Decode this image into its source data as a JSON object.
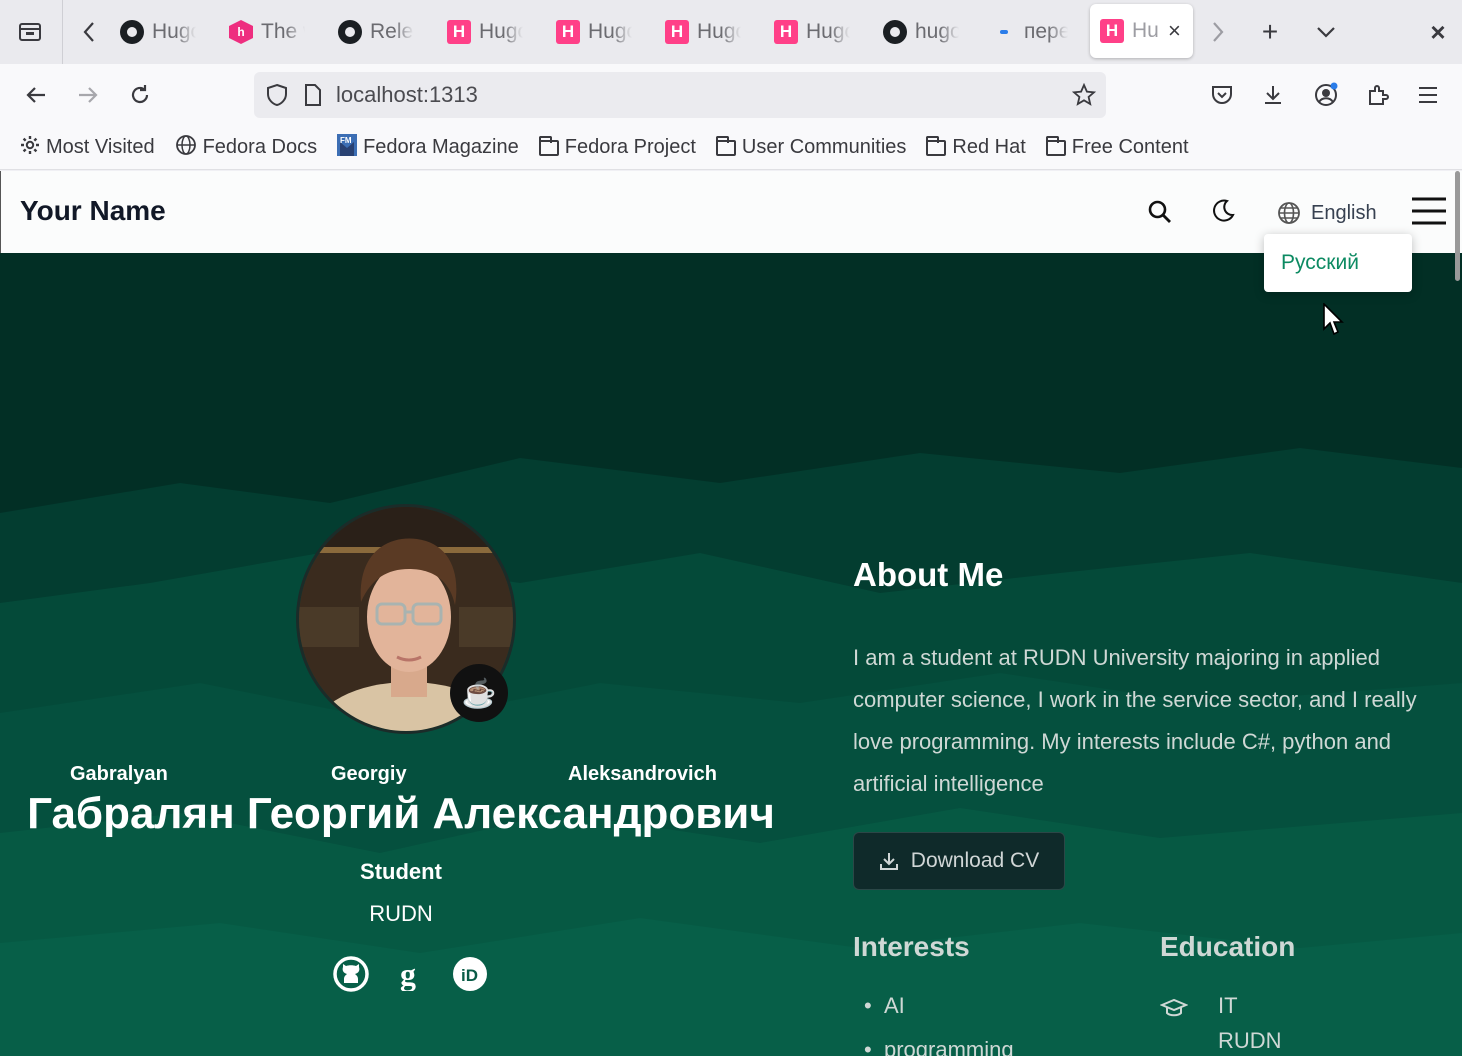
{
  "browser": {
    "tabs": [
      {
        "icon": "github-icon",
        "label": "Hugo"
      },
      {
        "icon": "hex-icon",
        "label": "The w"
      },
      {
        "icon": "github-icon",
        "label": "Relea"
      },
      {
        "icon": "hugo-icon",
        "label": "Hugo"
      },
      {
        "icon": "hugo-icon",
        "label": "Hugo"
      },
      {
        "icon": "hugo-icon",
        "label": "Hugo"
      },
      {
        "icon": "hugo-icon",
        "label": "Hugo"
      },
      {
        "icon": "github-icon",
        "label": "hugo"
      },
      {
        "icon": "dash-icon",
        "label": "пере"
      }
    ],
    "active_tab": {
      "icon": "hugo-icon",
      "label": "Hu"
    },
    "url": "localhost:1313",
    "bookmarks": [
      {
        "icon": "gear-icon",
        "label": "Most Visited"
      },
      {
        "icon": "globe-icon",
        "label": "Fedora Docs"
      },
      {
        "icon": "fm-icon",
        "label": "Fedora Magazine"
      },
      {
        "icon": "folder-icon",
        "label": "Fedora Project"
      },
      {
        "icon": "folder-icon",
        "label": "User Communities"
      },
      {
        "icon": "folder-icon",
        "label": "Red Hat"
      },
      {
        "icon": "folder-icon",
        "label": "Free Content"
      }
    ]
  },
  "site": {
    "title": "Your Name",
    "language_current": "English",
    "language_option": "Русский"
  },
  "profile": {
    "name_parts": [
      "Gabralyan",
      "Georgiy",
      "Aleksandrovich"
    ],
    "full_name": "Габралян Георгий Александрович",
    "role": "Student",
    "organization": "RUDN",
    "social_icons": [
      "github-icon",
      "google-scholar-icon",
      "orcid-icon"
    ]
  },
  "about": {
    "title": "About Me",
    "bio": "I am a student at RUDN University majoring in applied computer science, I work in the service sector, and I really love programming. My interests include C#, python and artificial intelligence",
    "cv_button": "Download CV",
    "interests_title": "Interests",
    "interests": [
      "AI",
      "programming"
    ],
    "education_title": "Education",
    "education": {
      "course": "IT",
      "institution": "RUDN"
    }
  },
  "colors": {
    "hero_dark": "#003d2e",
    "hero_mid": "#034a38",
    "hero_light": "#0a5c47",
    "accent": "#0c8a62"
  }
}
